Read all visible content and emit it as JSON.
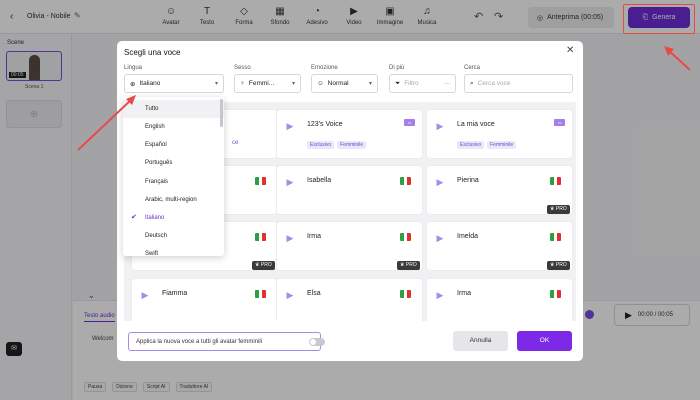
{
  "topbar": {
    "project_title": "Olivia - Nobile",
    "tools": [
      {
        "label": "Avatar",
        "icon": "avatar-icon",
        "glyph": "☺"
      },
      {
        "label": "Testo",
        "icon": "text-icon",
        "glyph": "T"
      },
      {
        "label": "Forma",
        "icon": "shape-icon",
        "glyph": "◇"
      },
      {
        "label": "Sfondo",
        "icon": "background-icon",
        "glyph": "▦"
      },
      {
        "label": "Adesivo",
        "icon": "sticker-icon",
        "glyph": "◔"
      },
      {
        "label": "Video",
        "icon": "video-icon",
        "glyph": "▶"
      },
      {
        "label": "Immagine",
        "icon": "image-icon",
        "glyph": "▣"
      },
      {
        "label": "Musica",
        "icon": "music-icon",
        "glyph": "♫"
      }
    ],
    "preview_label": "Anteprima (00:05)",
    "generate_label": "Genera"
  },
  "left_panel": {
    "title": "Scene",
    "scene_label": "Scena 1",
    "scene_duration": "00:05"
  },
  "bottom_panel": {
    "tab": "Testo audio",
    "text": "Welcom",
    "time": "00:00 / 00:05",
    "tools": [
      "Pausa",
      "Dizione",
      "Script AI",
      "Traduttore AI"
    ]
  },
  "modal": {
    "title": "Scegli una voce",
    "filters": {
      "lingua": {
        "label": "Lingua",
        "value": "Italiano"
      },
      "sesso": {
        "label": "Sesso",
        "value": "Femmi..."
      },
      "emozione": {
        "label": "Emozione",
        "value": "Normal"
      },
      "di_piu": {
        "label": "Di più",
        "value": "Filtro"
      },
      "cerca": {
        "label": "Cerca",
        "placeholder": "Cerca voce"
      }
    },
    "language_options": [
      "Tutto",
      "English",
      "Español",
      "Português",
      "Français",
      "Arabic, multi-region",
      "Italiano",
      "Deutsch",
      "Swift"
    ],
    "selected_language": "Italiano",
    "partial_card_text": "ce",
    "voices": [
      {
        "name": "123's Voice",
        "tags": [
          "Esclusivo",
          "Femminile"
        ],
        "badge": true,
        "pro": false,
        "flag": false
      },
      {
        "name": "La mia voce",
        "tags": [
          "Esclusivo",
          "Femminile"
        ],
        "badge": true,
        "pro": false,
        "flag": false
      },
      {
        "name": "",
        "tags": [],
        "badge": false,
        "pro": false,
        "flag": true
      },
      {
        "name": "Isabella",
        "tags": [],
        "badge": false,
        "pro": false,
        "flag": true
      },
      {
        "name": "Pierina",
        "tags": [],
        "badge": false,
        "pro": true,
        "flag": true
      },
      {
        "name": "",
        "tags": [],
        "badge": false,
        "pro": true,
        "flag": true
      },
      {
        "name": "Irma",
        "tags": [],
        "badge": false,
        "pro": true,
        "flag": true
      },
      {
        "name": "Imelda",
        "tags": [],
        "badge": false,
        "pro": true,
        "flag": true
      },
      {
        "name": "Fiamma",
        "tags": [],
        "badge": false,
        "pro": false,
        "flag": true
      },
      {
        "name": "Elsa",
        "tags": [],
        "badge": false,
        "pro": false,
        "flag": true
      },
      {
        "name": "Irma",
        "tags": [],
        "badge": false,
        "pro": false,
        "flag": true
      }
    ],
    "pro_label": "PRO",
    "apply_label": "Applica la nuova voce a tutti gli avatar femminili",
    "cancel_label": "Annulla",
    "ok_label": "OK"
  },
  "colors": {
    "accent": "#6d2ed8",
    "annotation": "#e84a4a",
    "flag_green": "#2f9e44",
    "flag_white": "#ffffff",
    "flag_red": "#e03131"
  }
}
